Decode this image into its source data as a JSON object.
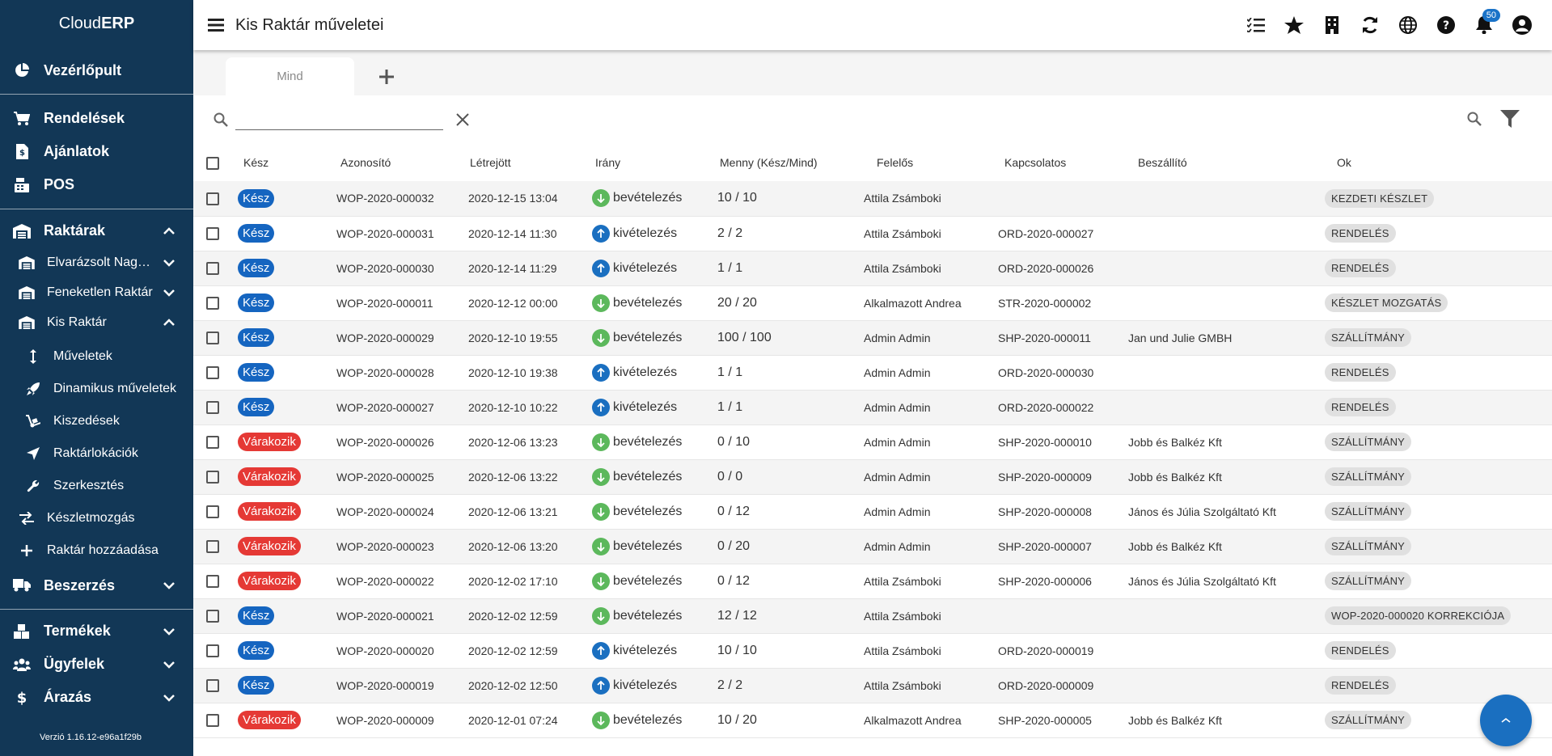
{
  "brand": {
    "prefix": "Cloud",
    "bold": "ERP"
  },
  "sidebar": {
    "dashboard": "Vezérlőpult",
    "orders": "Rendelések",
    "offers": "Ajánlatok",
    "pos": "POS",
    "warehouses": "Raktárak",
    "wh1": "Elvarázsolt Nagyraktár",
    "wh2": "Feneketlen Raktár",
    "wh3": "Kis Raktár",
    "ops": "Műveletek",
    "dynops": "Dinamikus műveletek",
    "picks": "Kiszedések",
    "locations": "Raktárlokációk",
    "edit": "Szerkesztés",
    "stockmove": "Készletmozgás",
    "addwh": "Raktár hozzáadása",
    "purchase": "Beszerzés",
    "products": "Termékek",
    "customers": "Ügyfelek",
    "pricing": "Árazás",
    "version": "Verzió 1.16.12-e96a1f29b"
  },
  "header": {
    "title": "Kis Raktár műveletei",
    "notif_count": "50"
  },
  "tabs": {
    "active": "Mind"
  },
  "search": {
    "placeholder": ""
  },
  "columns": [
    "Kész",
    "Azonosító",
    "Létrejött",
    "Irány",
    "Menny (Kész/Mind)",
    "Felelős",
    "Kapcsolatos",
    "Beszállító",
    "Ok"
  ],
  "rows": [
    {
      "status": "Kész",
      "st": "ok",
      "id": "WOP-2020-000032",
      "created": "2020-12-15 13:04",
      "dir": "bevételezés",
      "d": "in",
      "qty": "10 / 10",
      "resp": "Attila Zsámboki",
      "rel": "",
      "supp": "",
      "reason": "KEZDETI KÉSZLET"
    },
    {
      "status": "Kész",
      "st": "ok",
      "id": "WOP-2020-000031",
      "created": "2020-12-14 11:30",
      "dir": "kivételezés",
      "d": "out",
      "qty": "2 / 2",
      "resp": "Attila Zsámboki",
      "rel": "ORD-2020-000027",
      "supp": "",
      "reason": "RENDELÉS"
    },
    {
      "status": "Kész",
      "st": "ok",
      "id": "WOP-2020-000030",
      "created": "2020-12-14 11:29",
      "dir": "kivételezés",
      "d": "out",
      "qty": "1 / 1",
      "resp": "Attila Zsámboki",
      "rel": "ORD-2020-000026",
      "supp": "",
      "reason": "RENDELÉS"
    },
    {
      "status": "Kész",
      "st": "ok",
      "id": "WOP-2020-000011",
      "created": "2020-12-12 00:00",
      "dir": "bevételezés",
      "d": "in",
      "qty": "20 / 20",
      "resp": "Alkalmazott Andrea",
      "rel": "STR-2020-000002",
      "supp": "",
      "reason": "KÉSZLET MOZGATÁS"
    },
    {
      "status": "Kész",
      "st": "ok",
      "id": "WOP-2020-000029",
      "created": "2020-12-10 19:55",
      "dir": "bevételezés",
      "d": "in",
      "qty": "100 / 100",
      "resp": "Admin Admin",
      "rel": "SHP-2020-000011",
      "supp": "Jan und Julie GMBH",
      "reason": "SZÁLLÍTMÁNY"
    },
    {
      "status": "Kész",
      "st": "ok",
      "id": "WOP-2020-000028",
      "created": "2020-12-10 19:38",
      "dir": "kivételezés",
      "d": "out",
      "qty": "1 / 1",
      "resp": "Admin Admin",
      "rel": "ORD-2020-000030",
      "supp": "",
      "reason": "RENDELÉS"
    },
    {
      "status": "Kész",
      "st": "ok",
      "id": "WOP-2020-000027",
      "created": "2020-12-10 10:22",
      "dir": "kivételezés",
      "d": "out",
      "qty": "1 / 1",
      "resp": "Admin Admin",
      "rel": "ORD-2020-000022",
      "supp": "",
      "reason": "RENDELÉS"
    },
    {
      "status": "Várakozik",
      "st": "wait",
      "id": "WOP-2020-000026",
      "created": "2020-12-06 13:23",
      "dir": "bevételezés",
      "d": "in",
      "qty": "0 / 10",
      "resp": "Admin Admin",
      "rel": "SHP-2020-000010",
      "supp": "Jobb és Balkéz Kft",
      "reason": "SZÁLLÍTMÁNY"
    },
    {
      "status": "Várakozik",
      "st": "wait",
      "id": "WOP-2020-000025",
      "created": "2020-12-06 13:22",
      "dir": "bevételezés",
      "d": "in",
      "qty": "0 / 0",
      "resp": "Admin Admin",
      "rel": "SHP-2020-000009",
      "supp": "Jobb és Balkéz Kft",
      "reason": "SZÁLLÍTMÁNY"
    },
    {
      "status": "Várakozik",
      "st": "wait",
      "id": "WOP-2020-000024",
      "created": "2020-12-06 13:21",
      "dir": "bevételezés",
      "d": "in",
      "qty": "0 / 12",
      "resp": "Admin Admin",
      "rel": "SHP-2020-000008",
      "supp": "János és Júlia Szolgáltató Kft",
      "reason": "SZÁLLÍTMÁNY"
    },
    {
      "status": "Várakozik",
      "st": "wait",
      "id": "WOP-2020-000023",
      "created": "2020-12-06 13:20",
      "dir": "bevételezés",
      "d": "in",
      "qty": "0 / 20",
      "resp": "Admin Admin",
      "rel": "SHP-2020-000007",
      "supp": "Jobb és Balkéz Kft",
      "reason": "SZÁLLÍTMÁNY"
    },
    {
      "status": "Várakozik",
      "st": "wait",
      "id": "WOP-2020-000022",
      "created": "2020-12-02 17:10",
      "dir": "bevételezés",
      "d": "in",
      "qty": "0 / 12",
      "resp": "Attila Zsámboki",
      "rel": "SHP-2020-000006",
      "supp": "János és Júlia Szolgáltató Kft",
      "reason": "SZÁLLÍTMÁNY"
    },
    {
      "status": "Kész",
      "st": "ok",
      "id": "WOP-2020-000021",
      "created": "2020-12-02 12:59",
      "dir": "bevételezés",
      "d": "in",
      "qty": "12 / 12",
      "resp": "Attila Zsámboki",
      "rel": "",
      "supp": "",
      "reason": "WOP-2020-000020 KORREKCIÓJA"
    },
    {
      "status": "Kész",
      "st": "ok",
      "id": "WOP-2020-000020",
      "created": "2020-12-02 12:59",
      "dir": "kivételezés",
      "d": "out",
      "qty": "10 / 10",
      "resp": "Attila Zsámboki",
      "rel": "ORD-2020-000019",
      "supp": "",
      "reason": "RENDELÉS"
    },
    {
      "status": "Kész",
      "st": "ok",
      "id": "WOP-2020-000019",
      "created": "2020-12-02 12:50",
      "dir": "kivételezés",
      "d": "out",
      "qty": "2 / 2",
      "resp": "Attila Zsámboki",
      "rel": "ORD-2020-000009",
      "supp": "",
      "reason": "RENDELÉS"
    },
    {
      "status": "Várakozik",
      "st": "wait",
      "id": "WOP-2020-000009",
      "created": "2020-12-01 07:24",
      "dir": "bevételezés",
      "d": "in",
      "qty": "10 / 20",
      "resp": "Alkalmazott Andrea",
      "rel": "SHP-2020-000005",
      "supp": "Jobb és Balkéz Kft",
      "reason": "SZÁLLÍTMÁNY"
    }
  ]
}
